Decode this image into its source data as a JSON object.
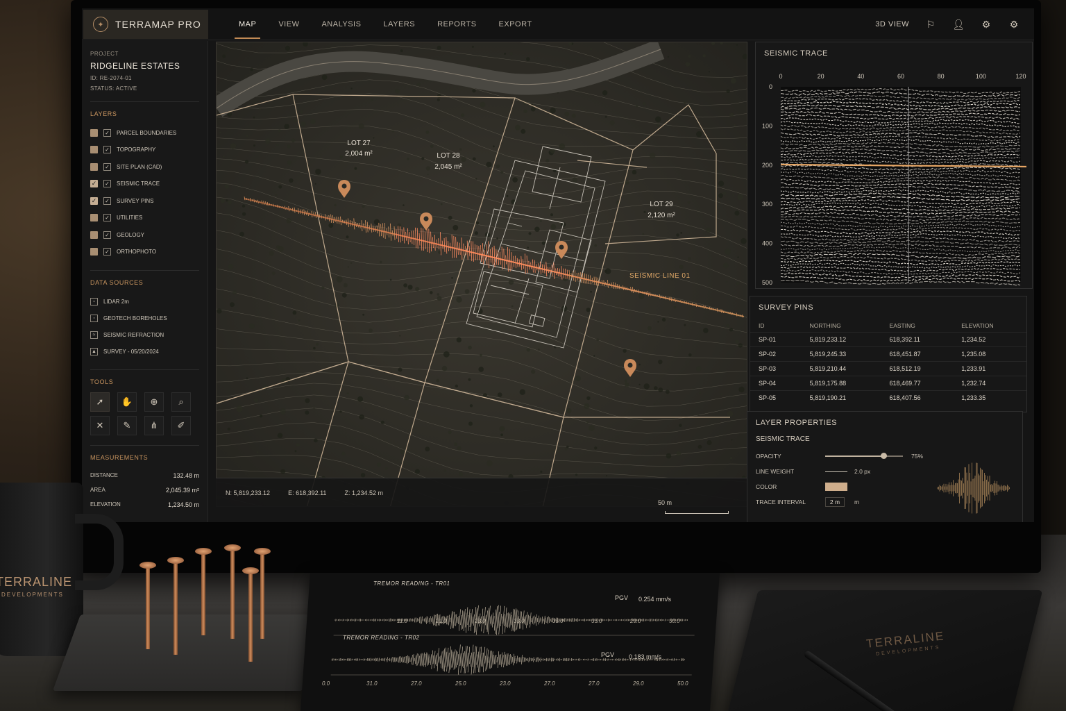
{
  "app": {
    "name": "TERRAMAP PRO"
  },
  "nav": {
    "items": [
      "MAP",
      "VIEW",
      "ANALYSIS",
      "LAYERS",
      "REPORTS",
      "EXPORT"
    ],
    "active": "MAP",
    "view3d": "3D VIEW"
  },
  "project": {
    "label": "PROJECT",
    "name": "RIDGELINE ESTATES",
    "id": "ID: RE-2074-01",
    "status": "STATUS: ACTIVE"
  },
  "layers": {
    "title": "LAYERS",
    "items": [
      {
        "label": "PARCEL BOUNDARIES",
        "visible": false
      },
      {
        "label": "TOPOGRAPHY",
        "visible": false
      },
      {
        "label": "SITE PLAN (CAD)",
        "visible": false
      },
      {
        "label": "SEISMIC TRACE",
        "visible": true
      },
      {
        "label": "SURVEY PINS",
        "visible": true
      },
      {
        "label": "UTILITIES",
        "visible": false
      },
      {
        "label": "GEOLOGY",
        "visible": false
      },
      {
        "label": "ORTHOPHOTO",
        "visible": false
      }
    ]
  },
  "data_sources": {
    "title": "DATA SOURCES",
    "items": [
      "LIDAR 2m",
      "GEOTECH BOREHOLES",
      "SEISMIC REFRACTION",
      "SURVEY - 05/20/2024"
    ]
  },
  "tools": {
    "title": "TOOLS"
  },
  "measurements": {
    "title": "MEASUREMENTS",
    "rows": [
      {
        "label": "DISTANCE",
        "value": "132.48 m"
      },
      {
        "label": "AREA",
        "value": "2,045.39 m²"
      },
      {
        "label": "ELEVATION",
        "value": "1,234.50 m"
      }
    ]
  },
  "map": {
    "lots": [
      {
        "name": "LOT 27",
        "area": "2,004 m²"
      },
      {
        "name": "LOT 28",
        "area": "2,045 m²"
      },
      {
        "name": "LOT 29",
        "area": "2,120 m²"
      }
    ],
    "seismic_line_label": "SEISMIC LINE 01",
    "coords": {
      "n": "N: 5,819,233.12",
      "e": "E: 618,392.11",
      "z": "Z: 1,234.52 m"
    },
    "scale": "50 m"
  },
  "seismic_trace": {
    "title": "SEISMIC TRACE",
    "x_ticks": [
      "0",
      "20",
      "40",
      "60",
      "80",
      "100",
      "120"
    ],
    "y_ticks": [
      "0",
      "100",
      "200",
      "300",
      "400",
      "500"
    ]
  },
  "survey_pins": {
    "title": "SURVEY PINS",
    "columns": [
      "ID",
      "NORTHING",
      "EASTING",
      "ELEVATION"
    ],
    "rows": [
      [
        "SP-01",
        "5,819,233.12",
        "618,392.11",
        "1,234.52"
      ],
      [
        "SP-02",
        "5,819,245.33",
        "618,451.87",
        "1,235.08"
      ],
      [
        "SP-03",
        "5,819,210.44",
        "618,512.19",
        "1,233.91"
      ],
      [
        "SP-04",
        "5,819,175.88",
        "618,469.77",
        "1,232.74"
      ],
      [
        "SP-05",
        "5,819,190.21",
        "618,407.56",
        "1,233.35"
      ]
    ]
  },
  "layer_properties": {
    "title": "LAYER PROPERTIES",
    "subtitle": "SEISMIC TRACE",
    "opacity_label": "OPACITY",
    "opacity_value": "75%",
    "opacity_fraction": 0.75,
    "line_weight_label": "LINE WEIGHT",
    "line_weight_value": "2.0 px",
    "color_label": "COLOR",
    "color_value": "#cfae8c",
    "interval_label": "TRACE INTERVAL",
    "interval_value": "2 m",
    "interval_unit": "m"
  },
  "desk": {
    "mug_brand": "TERRALINE",
    "mug_sub": "DEVELOPMENTS",
    "notebook_brand": "TERRALINE",
    "notebook_sub": "DEVELOPMENTS",
    "tremor": [
      {
        "title": "TREMOR READING - TR01",
        "pgv_label": "PGV",
        "pgv_value": "0.254 mm/s",
        "ticks": [
          "11.0",
          "21.0",
          "23.0",
          "33.0",
          "35.0",
          "35.0",
          "29.0",
          "30.0"
        ]
      },
      {
        "title": "TREMOR READING - TR02",
        "pgv_label": "PGV",
        "pgv_value": "0.183 mm/s",
        "ticks": [
          "0.0",
          "31.0",
          "27.0",
          "25.0",
          "23.0",
          "27.0",
          "27.0",
          "29.0",
          "50.0"
        ]
      }
    ]
  }
}
